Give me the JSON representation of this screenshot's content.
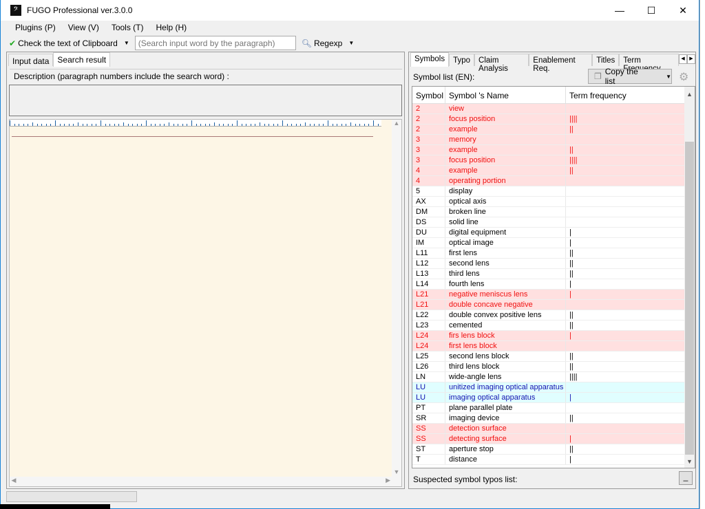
{
  "window": {
    "title": "FUGO Professional ver.3.0.0",
    "minimize": "—",
    "maximize": "☐",
    "close": "✕"
  },
  "menu": [
    "Plugins (P)",
    "View (V)",
    "Tools (T)",
    "Help (H)"
  ],
  "toolbar": {
    "check_clipboard": "Check the text of Clipboard",
    "search_placeholder": "(Search input word by the paragraph)",
    "regexp": "Regexp"
  },
  "left": {
    "tabs": [
      "Input data",
      "Search result"
    ],
    "active_tab": "Search result",
    "description_label": "Description (paragraph numbers include the search word) :"
  },
  "right": {
    "tabs": [
      "Symbols",
      "Typo",
      "Claim Analysis",
      "Enablement Req.",
      "Titles",
      "Term Frequency"
    ],
    "active_tab": "Symbols",
    "symbol_list_label": "Symbol list (EN):",
    "copy_button": "Copy the list",
    "columns": [
      "Symbol",
      "Symbol 's Name",
      "Term frequency"
    ],
    "rows": [
      [
        "2",
        "view",
        "",
        "red"
      ],
      [
        "2",
        "focus position",
        "||||",
        "red"
      ],
      [
        "2",
        "example",
        "||",
        "red"
      ],
      [
        "3",
        "memory",
        "",
        "red"
      ],
      [
        "3",
        "example",
        "||",
        "red"
      ],
      [
        "3",
        "focus position",
        "||||",
        "red"
      ],
      [
        "4",
        "example",
        "||",
        "red"
      ],
      [
        "4",
        "operating portion",
        "",
        "red"
      ],
      [
        "5",
        "display",
        "",
        ""
      ],
      [
        "AX",
        "optical axis",
        "",
        ""
      ],
      [
        "DM",
        "broken line",
        "",
        ""
      ],
      [
        "DS",
        "solid line",
        "",
        ""
      ],
      [
        "DU",
        "digital equipment",
        "|",
        ""
      ],
      [
        "IM",
        "optical image",
        "|",
        ""
      ],
      [
        "L11",
        "first lens",
        "||",
        ""
      ],
      [
        "L12",
        "second lens",
        "||",
        ""
      ],
      [
        "L13",
        "third lens",
        "||",
        ""
      ],
      [
        "L14",
        "fourth lens",
        "|",
        ""
      ],
      [
        "L21",
        "negative meniscus lens",
        "|",
        "red"
      ],
      [
        "L21",
        "double concave negative",
        "",
        "red"
      ],
      [
        "L22",
        "double convex positive lens",
        "||",
        ""
      ],
      [
        "L23",
        "cemented",
        "||",
        ""
      ],
      [
        "L24",
        "firs lens block",
        "|",
        "red"
      ],
      [
        "L24",
        "first lens block",
        "",
        "red"
      ],
      [
        "L25",
        "second lens block",
        "||",
        ""
      ],
      [
        "L26",
        "third lens block",
        "||",
        ""
      ],
      [
        "LN",
        "wide-angle lens",
        "||||",
        ""
      ],
      [
        "LU",
        "unitized imaging optical apparatus",
        "",
        "blue"
      ],
      [
        "LU",
        "imaging optical apparatus",
        "|",
        "blue"
      ],
      [
        "PT",
        "plane parallel plate",
        "",
        ""
      ],
      [
        "SR",
        "imaging device",
        "||",
        ""
      ],
      [
        "SS",
        "detection surface",
        "",
        "red"
      ],
      [
        "SS",
        "detecting surface",
        "|",
        "red"
      ],
      [
        "ST",
        "aperture stop",
        "||",
        ""
      ],
      [
        "T",
        "distance",
        "|",
        ""
      ]
    ],
    "typos_label": "Suspected symbol typos list:"
  },
  "colors": {
    "highlight_red_bg": "#ffe0e0",
    "highlight_red_text": "#f01010",
    "highlight_blue_bg": "#e0feff",
    "highlight_blue_text": "#1010b0"
  }
}
